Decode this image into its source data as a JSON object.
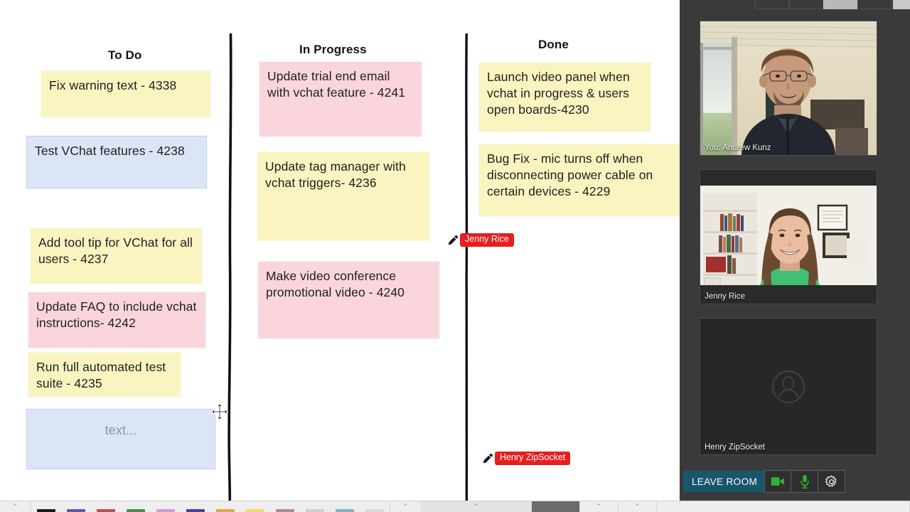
{
  "board": {
    "columns": [
      {
        "title": "To Do"
      },
      {
        "title": "In Progress"
      },
      {
        "title": "Done"
      }
    ],
    "notes": {
      "todo": [
        {
          "text": "Fix warning text - 4338",
          "color": "yellow"
        },
        {
          "text": "Test VChat features - 4238",
          "color": "blue"
        },
        {
          "text": "Add tool tip for VChat for all users - 4237",
          "color": "yellow"
        },
        {
          "text": "Update FAQ to include vchat instructions- 4242",
          "color": "pink"
        },
        {
          "text": "Run full automated test suite - 4235",
          "color": "yellow"
        },
        {
          "text": "text...",
          "color": "blue"
        }
      ],
      "inprogress": [
        {
          "text": "Update trial end email with vchat feature - 4241",
          "color": "pink"
        },
        {
          "text": "Update tag manager with vchat triggers- 4236",
          "color": "yellow"
        },
        {
          "text": "Make video conference promotional video - 4240",
          "color": "pink"
        }
      ],
      "done": [
        {
          "text": "Launch video panel when vchat in progress & users open boards-4230",
          "color": "yellow"
        },
        {
          "text": "Bug Fix - mic turns off when disconnecting power cable on certain devices - 4229",
          "color": "yellow"
        }
      ]
    },
    "cursors": [
      {
        "label": "Jenny Rice",
        "color": "#e51f1f"
      },
      {
        "label": "Henry ZipSocket",
        "color": "#e51f1f"
      }
    ]
  },
  "video_panel": {
    "participants": [
      {
        "name": "You: Andrew Kunz",
        "has_video": true
      },
      {
        "name": "Jenny Rice",
        "has_video": true
      },
      {
        "name": "Henry ZipSocket",
        "has_video": false
      }
    ],
    "controls": {
      "leave_label": "LEAVE ROOM",
      "camera_icon": "video-camera-icon",
      "mic_icon": "microphone-icon",
      "settings_icon": "gear-icon",
      "active_color": "#34b233",
      "leave_color": "#17566b"
    }
  },
  "taskbar": {
    "swatches": [
      "#1a1a1a",
      "#5a5aa8",
      "#c05050",
      "#4e8a4e",
      "#d39ad8",
      "#4b3f9e",
      "#e0a84a",
      "#ecd96a",
      "#b08a8a",
      "#cfcfcf",
      "#7fb3c0",
      "#d8d8d8"
    ],
    "chevron": "⌃"
  }
}
